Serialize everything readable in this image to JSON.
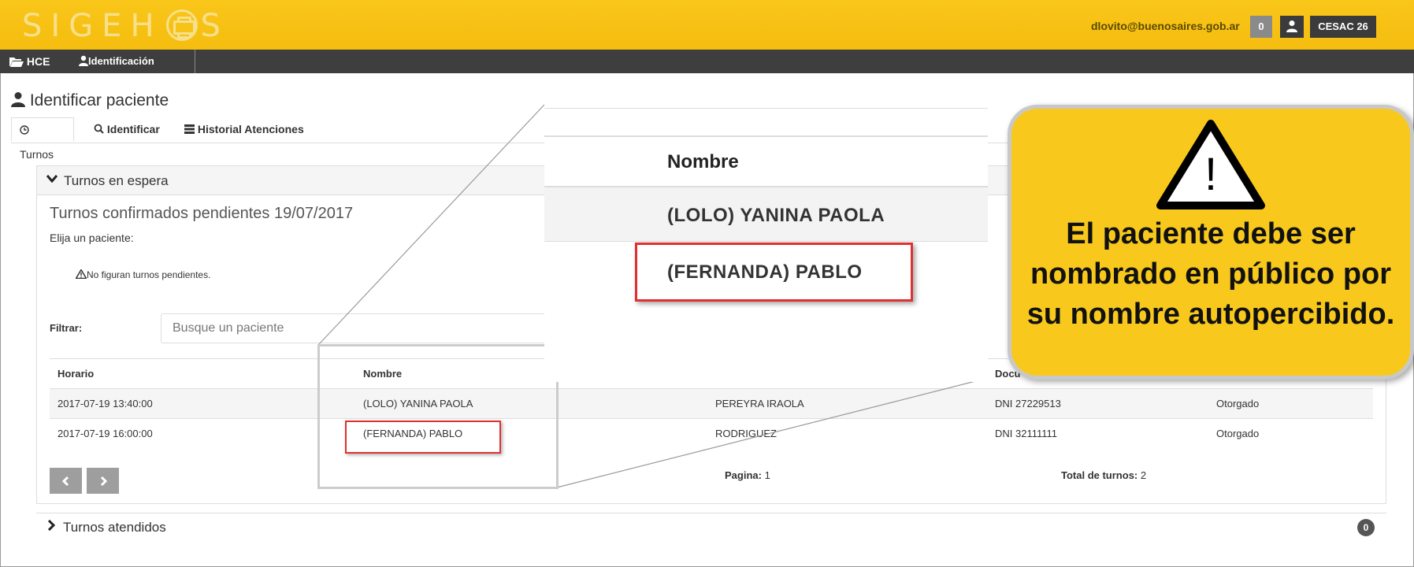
{
  "header": {
    "app_name": "SIGEH",
    "app_name_tail": "S",
    "user_email": "dlovito@buenosaires.gob.ar",
    "notification_count": "0",
    "site": "CESAC 26"
  },
  "nav": {
    "hce": "HCE",
    "identificacion": "Identificación"
  },
  "page": {
    "title": "Identificar paciente",
    "tabs": [
      {
        "label": "Turnos"
      },
      {
        "label": "Identificar"
      },
      {
        "label": "Historial Atenciones"
      }
    ]
  },
  "panel": {
    "title": "Turnos en espera",
    "subtitle": "Turnos confirmados pendientes 19/07/2017",
    "hint": "Elija un paciente:",
    "warning": "No figuran turnos pendientes.",
    "filter_label": "Filtrar:",
    "filter_placeholder": "Busque un paciente",
    "columns": [
      "Horario",
      "Nombre",
      "",
      "Docu",
      ""
    ],
    "rows": [
      {
        "horario": "2017-07-19 13:40:00",
        "nombre": "(LOLO) YANINA PAOLA",
        "apellido": "PEREYRA IRAOLA",
        "documento": "DNI 27229513",
        "estado": "Otorgado"
      },
      {
        "horario": "2017-07-19 16:00:00",
        "nombre": "(FERNANDA) PABLO",
        "apellido": "RODRIGUEZ",
        "documento": "DNI 32111111",
        "estado": "Otorgado"
      }
    ],
    "pagina_label": "Pagina:",
    "pagina_value": "1",
    "total_label": "Total de turnos:",
    "total_value": "2"
  },
  "panel_atendidos": {
    "title": "Turnos atendidos",
    "count": "0"
  },
  "zoom": {
    "header": "Nombre",
    "row1": "(LOLO) YANINA PAOLA",
    "row2": "(FERNANDA) PABLO"
  },
  "callout": {
    "symbol": "!",
    "text": "El paciente debe ser nombrado en público por su nombre autopercibido."
  },
  "colors": {
    "header_yellow": "#f6c418",
    "nav_dark": "#3e3e3e",
    "highlight_red": "#e03030",
    "callout_yellow": "#f8c91c"
  }
}
